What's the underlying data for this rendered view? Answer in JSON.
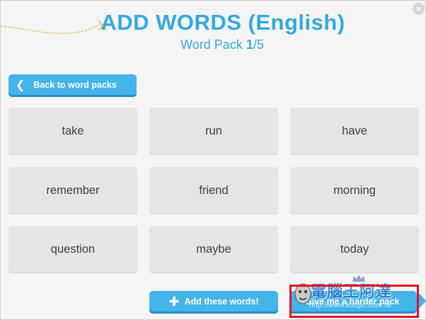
{
  "header": {
    "title": "ADD WORDS (English)",
    "subtitle_prefix": "Word Pack ",
    "subtitle_current": "1",
    "subtitle_suffix": "/5"
  },
  "close_label": "×",
  "back_button": {
    "label": "Back to word packs",
    "icon": "chevron-left-icon"
  },
  "words": [
    "take",
    "run",
    "have",
    "remember",
    "friend",
    "morning",
    "question",
    "maybe",
    "today"
  ],
  "footer": {
    "add_label": "Add these words!",
    "add_icon": "plus-icon",
    "harder_label": "Give me a harder pack"
  },
  "watermark": {
    "title": "電腦王阿達",
    "url": "http://www.kocpc.com.tw"
  },
  "colors": {
    "accent": "#33a9e0",
    "button": "#44b4ea",
    "card": "#e5e5e5",
    "highlight": "#e8111f",
    "deco_string": "#f2b45a"
  }
}
